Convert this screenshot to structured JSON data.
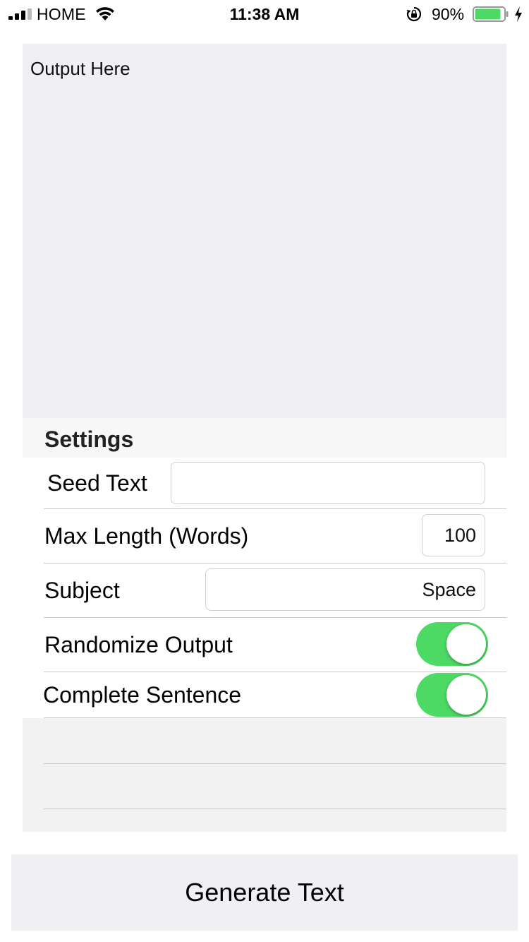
{
  "status_bar": {
    "carrier": "HOME",
    "time": "11:38 AM",
    "battery_percent": "90%",
    "battery_level": 0.9,
    "signal_bars": 3,
    "icons": [
      "signal-icon",
      "wifi-icon",
      "lock-rotation-icon",
      "battery-icon",
      "charging-icon"
    ]
  },
  "output": {
    "text": "Output Here"
  },
  "settings": {
    "title": "Settings",
    "seed_text": {
      "label": "Seed Text",
      "value": ""
    },
    "max_length": {
      "label": "Max Length (Words)",
      "value": "100"
    },
    "subject": {
      "label": "Subject",
      "value": "Space"
    },
    "randomize_output": {
      "label": "Randomize Output",
      "on": true
    },
    "complete_sentence": {
      "label": "Complete Sentence",
      "on": true
    }
  },
  "generate_button": {
    "label": "Generate Text"
  },
  "colors": {
    "toggle_on": "#4cd964",
    "battery_fill": "#4cd964",
    "panel_background": "#efeff4"
  }
}
